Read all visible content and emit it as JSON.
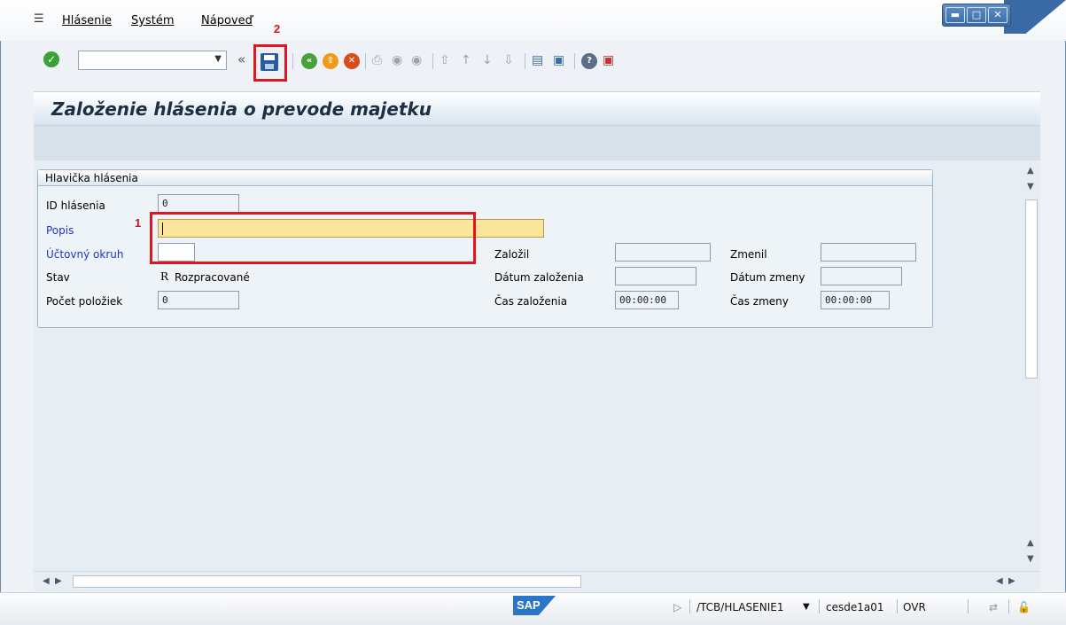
{
  "menu": {
    "items": [
      {
        "label": "Hlásenie"
      },
      {
        "label": "Systém"
      },
      {
        "label": "Nápoveď"
      }
    ]
  },
  "annotations": {
    "box1": "1",
    "box2": "2"
  },
  "toolbar": {
    "command_value": "",
    "back_chevron": "«"
  },
  "screen": {
    "title": "Založenie hlásenia o prevode majetku"
  },
  "header_group": {
    "title": "Hlavička hlásenia",
    "fields": {
      "id": {
        "label": "ID hlásenia",
        "value": "0"
      },
      "popis": {
        "label": "Popis",
        "value": ""
      },
      "uctovny_okruh": {
        "label": "Účtovný okruh",
        "value": ""
      },
      "stav": {
        "label": "Stav",
        "code": "R",
        "text": "Rozpracované"
      },
      "pocet": {
        "label": "Počet položiek",
        "value": "0"
      },
      "zalozil": {
        "label": "Založil",
        "value": ""
      },
      "datum_zalozenia": {
        "label": "Dátum založenia",
        "value": ""
      },
      "cas_zalozenia": {
        "label": "Čas založenia",
        "value": "00:00:00"
      },
      "zmenil": {
        "label": "Zmenil",
        "value": ""
      },
      "datum_zmeny": {
        "label": "Dátum zmeny",
        "value": ""
      },
      "cas_zmeny": {
        "label": "Čas zmeny",
        "value": "00:00:00"
      }
    }
  },
  "status": {
    "logo": "SAP",
    "transaction": "/TCB/HLASENIE1",
    "server": "cesde1a01",
    "mode": "OVR"
  },
  "colors": {
    "required_label": "#1a37c8",
    "annotation_red": "#e0151f",
    "input_highlight": "#fbe59a"
  }
}
